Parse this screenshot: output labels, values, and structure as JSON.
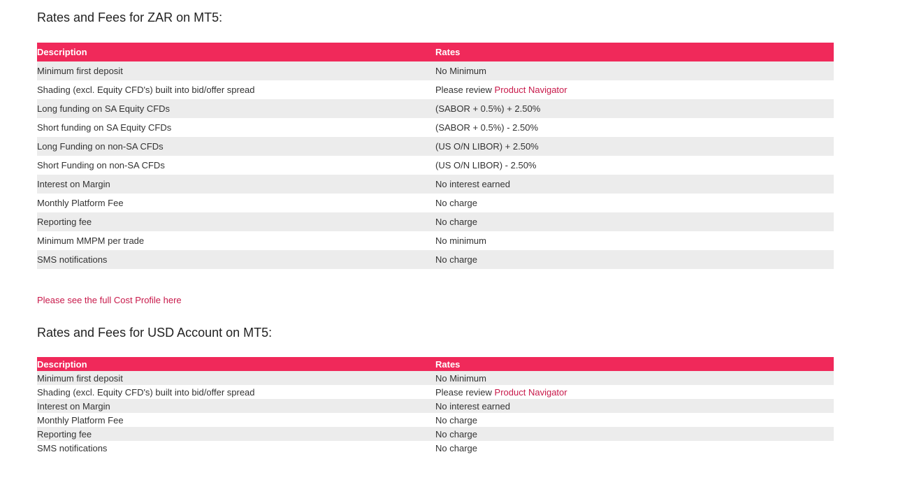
{
  "section1": {
    "title": "Rates and Fees for ZAR on MT5:",
    "header": {
      "description": "Description",
      "rates": "Rates"
    },
    "rows": [
      {
        "description": "Minimum first deposit",
        "rate": "No Minimum"
      },
      {
        "description": "Shading (excl. Equity CFD's) built into bid/offer spread",
        "rate_prefix": "Please review ",
        "rate_link": "Product Navigator"
      },
      {
        "description": "Long funding on SA Equity CFDs",
        "rate": "(SABOR + 0.5%) + 2.50%"
      },
      {
        "description": "Short funding on SA Equity CFDs",
        "rate": "(SABOR + 0.5%) - 2.50%"
      },
      {
        "description": "Long Funding on non-SA CFDs",
        "rate": "(US O/N LIBOR) + 2.50%"
      },
      {
        "description": "Short Funding on non-SA CFDs",
        "rate": "(US O/N LIBOR) - 2.50%"
      },
      {
        "description": "Interest on Margin",
        "rate": "No interest earned"
      },
      {
        "description": "Monthly Platform Fee",
        "rate": "No charge"
      },
      {
        "description": "Reporting fee",
        "rate": "No charge"
      },
      {
        "description": "Minimum MMPM per trade",
        "rate": "No minimum"
      },
      {
        "description": "SMS notifications",
        "rate": "No charge"
      }
    ]
  },
  "cost_profile_link": "Please see the full Cost Profile here",
  "section2": {
    "title": "Rates and Fees for USD Account on MT5:",
    "header": {
      "description": "Description",
      "rates": "Rates"
    },
    "rows": [
      {
        "description": "Minimum first deposit",
        "rate": "No Minimum"
      },
      {
        "description": "Shading (excl. Equity CFD's) built into bid/offer spread",
        "rate_prefix": "Please review ",
        "rate_link": "Product Navigator"
      },
      {
        "description": "Interest on Margin",
        "rate": "No interest earned"
      },
      {
        "description": "Monthly Platform Fee",
        "rate": "No charge"
      },
      {
        "description": "Reporting fee",
        "rate": "No charge"
      },
      {
        "description": "SMS notifications",
        "rate": "No charge"
      }
    ]
  },
  "colors": {
    "header_bg": "#f0295a",
    "row_alt_bg": "#ececec",
    "link": "#c8194a"
  }
}
